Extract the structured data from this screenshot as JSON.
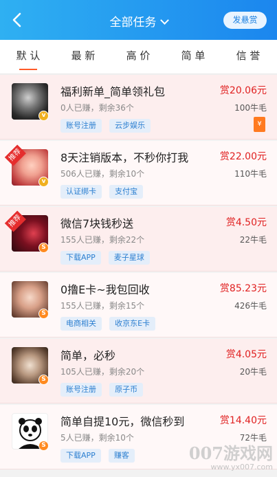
{
  "header": {
    "title": "全部任务",
    "post_button": "发悬赏",
    "colors": {
      "start": "#2fb0f2",
      "end": "#1b86ee"
    }
  },
  "tabs": [
    {
      "label": "默 认",
      "active": true
    },
    {
      "label": "最 新",
      "active": false
    },
    {
      "label": "高 价",
      "active": false
    },
    {
      "label": "简 单",
      "active": false
    },
    {
      "label": "信 誉",
      "active": false
    }
  ],
  "tasks": [
    {
      "title": "福利新单_简单领礼包",
      "stats": "0人已赚，剩余36个",
      "tags": [
        "账号注册",
        "云步娱乐"
      ],
      "reward": "赏20.06元",
      "sub": "100牛毛",
      "badge": "v",
      "recommended": false,
      "hongbao": true
    },
    {
      "title": "8天注销版本，不秒你打我",
      "stats": "506人已赚，剩余10个",
      "tags": [
        "认证绑卡",
        "支付宝"
      ],
      "reward": "赏22.00元",
      "sub": "110牛毛",
      "badge": "v",
      "recommended": true,
      "hongbao": false
    },
    {
      "title": "微信7块钱秒送",
      "stats": "155人已赚，剩余22个",
      "tags": [
        "下载APP",
        "麦子星球"
      ],
      "reward": "赏4.50元",
      "sub": "22牛毛",
      "badge": "S",
      "recommended": true,
      "hongbao": false
    },
    {
      "title": "0撸E卡~我包回收",
      "stats": "155人已赚，剩余15个",
      "tags": [
        "电商相关",
        "收京东E卡"
      ],
      "reward": "赏85.23元",
      "sub": "426牛毛",
      "badge": "S",
      "recommended": false,
      "hongbao": false
    },
    {
      "title": "简单，必秒",
      "stats": "105人已赚，剩余20个",
      "tags": [
        "账号注册",
        "原子币"
      ],
      "reward": "赏4.05元",
      "sub": "20牛毛",
      "badge": "S",
      "recommended": false,
      "hongbao": false
    },
    {
      "title": "简单自提10元，微信秒到",
      "stats": "5人已赚，剩余10个",
      "tags": [
        "下载APP",
        "赚客"
      ],
      "reward": "赏14.40元",
      "sub": "72牛毛",
      "badge": "S",
      "recommended": false,
      "hongbao": false
    }
  ],
  "recommended_label": "推荐",
  "hongbao_glyph": "¥",
  "watermark": {
    "main": "007游戏网",
    "url": "www.yx007.com"
  }
}
